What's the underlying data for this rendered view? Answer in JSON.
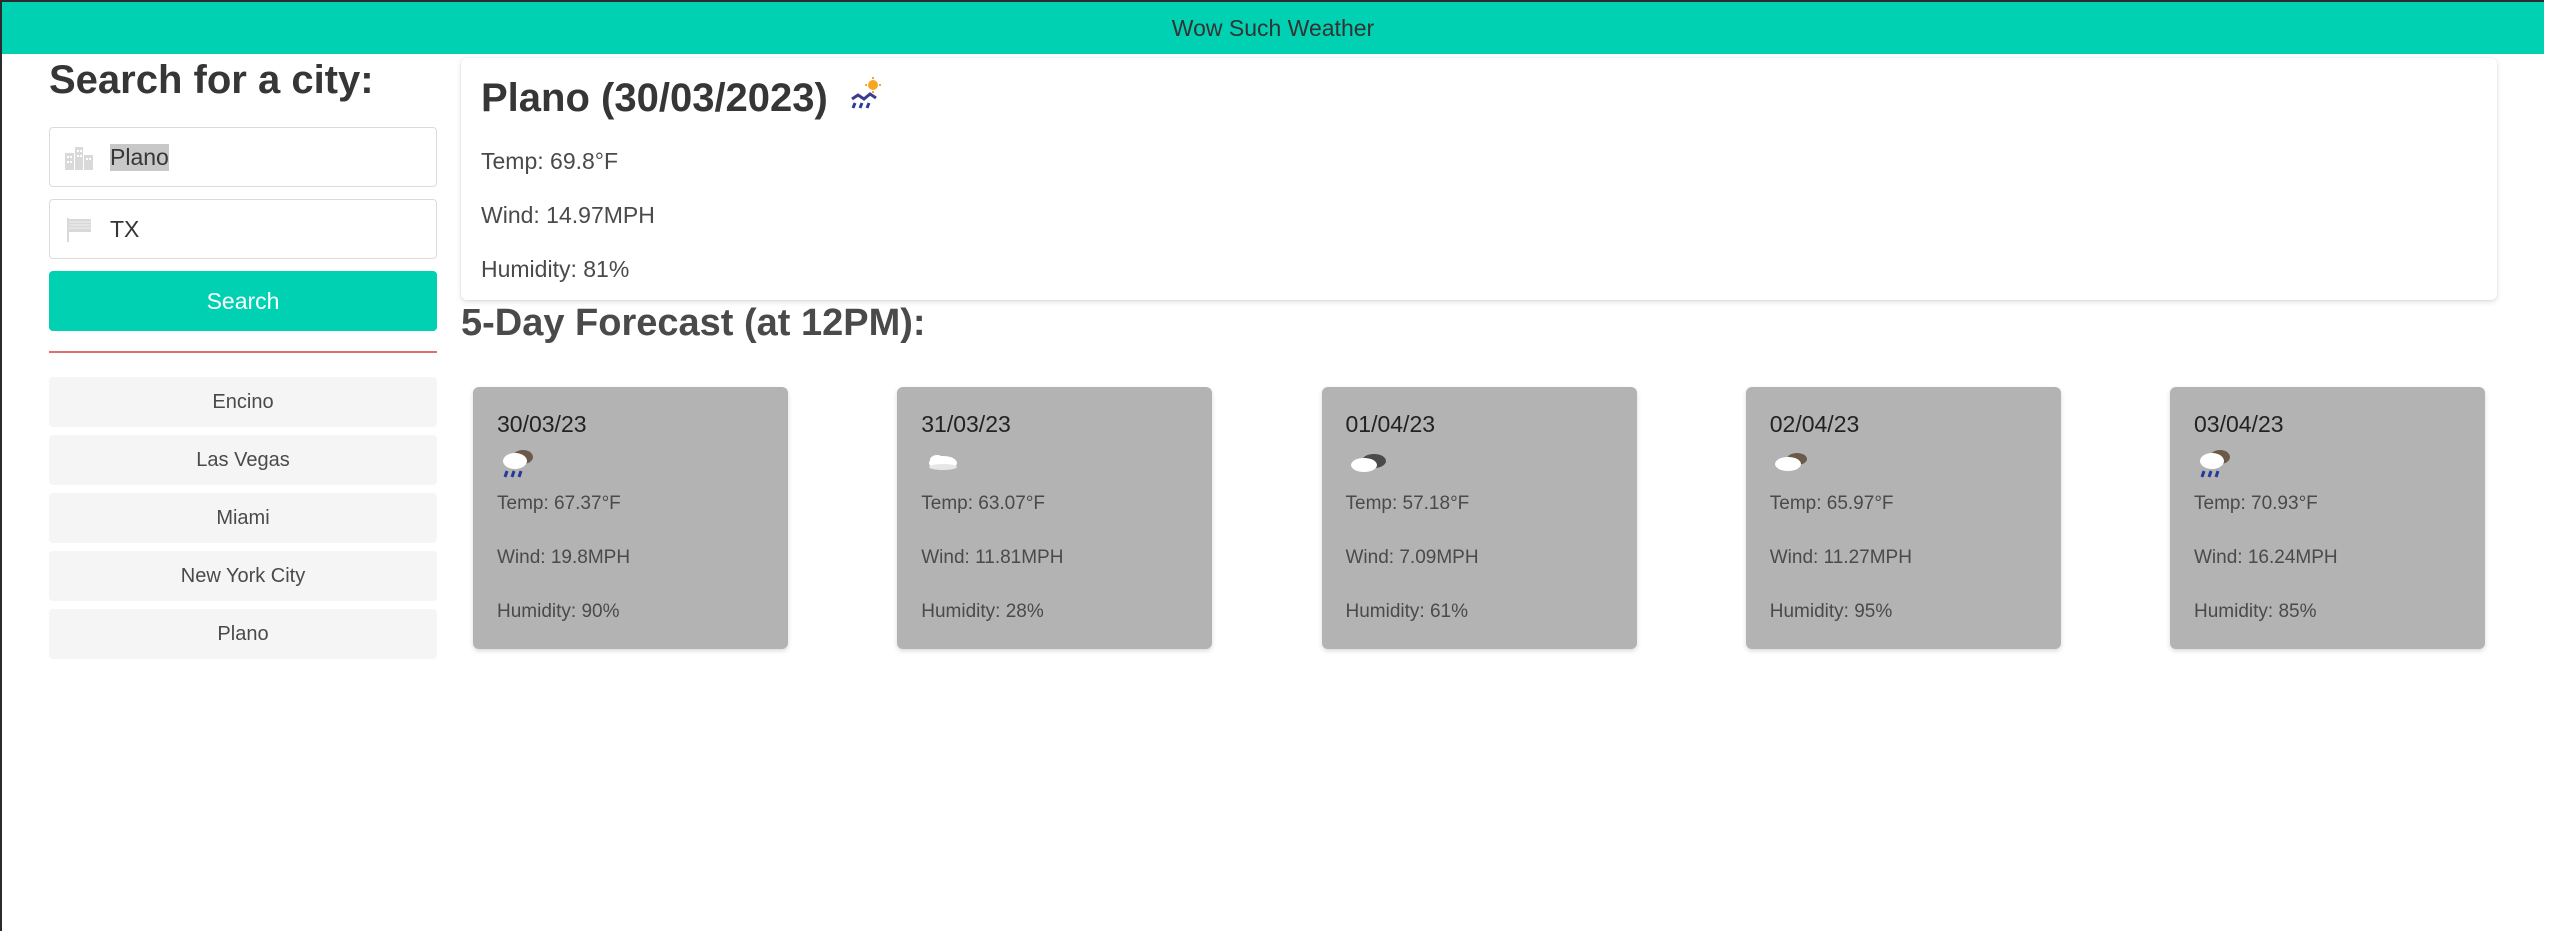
{
  "header": {
    "title": "Wow Such Weather"
  },
  "sidebar": {
    "heading": "Search for a city:",
    "city_input": {
      "value": "Plano",
      "icon": "city-icon"
    },
    "state_input": {
      "value": "TX",
      "icon": "flag-icon"
    },
    "search_label": "Search",
    "history": [
      "Encino",
      "Las Vegas",
      "Miami",
      "New York City",
      "Plano"
    ]
  },
  "current": {
    "title": "Plano (30/03/2023)",
    "icon": "rain-sun-icon",
    "temp": "Temp: 69.8°F",
    "wind": "Wind: 14.97MPH",
    "humidity": "Humidity: 81%"
  },
  "forecast": {
    "heading": "5-Day Forecast (at 12PM):",
    "days": [
      {
        "date": "30/03/23",
        "icon": "rain-cloud-icon",
        "temp": "Temp: 67.37°F",
        "wind": "Wind: 19.8MPH",
        "humidity": "Humidity: 90%"
      },
      {
        "date": "31/03/23",
        "icon": "cloud-icon",
        "temp": "Temp: 63.07°F",
        "wind": "Wind: 11.81MPH",
        "humidity": "Humidity: 28%"
      },
      {
        "date": "01/04/23",
        "icon": "dark-cloud-icon",
        "temp": "Temp: 57.18°F",
        "wind": "Wind: 7.09MPH",
        "humidity": "Humidity: 61%"
      },
      {
        "date": "02/04/23",
        "icon": "overcast-cloud-icon",
        "temp": "Temp: 65.97°F",
        "wind": "Wind: 11.27MPH",
        "humidity": "Humidity: 95%"
      },
      {
        "date": "03/04/23",
        "icon": "rain-cloud-icon",
        "temp": "Temp: 70.93°F",
        "wind": "Wind: 16.24MPH",
        "humidity": "Humidity: 85%"
      }
    ]
  },
  "colors": {
    "accent": "#00d1b2",
    "divider": "#e07070",
    "forecast_card": "#b3b3b3",
    "history_item": "#f5f5f5"
  }
}
